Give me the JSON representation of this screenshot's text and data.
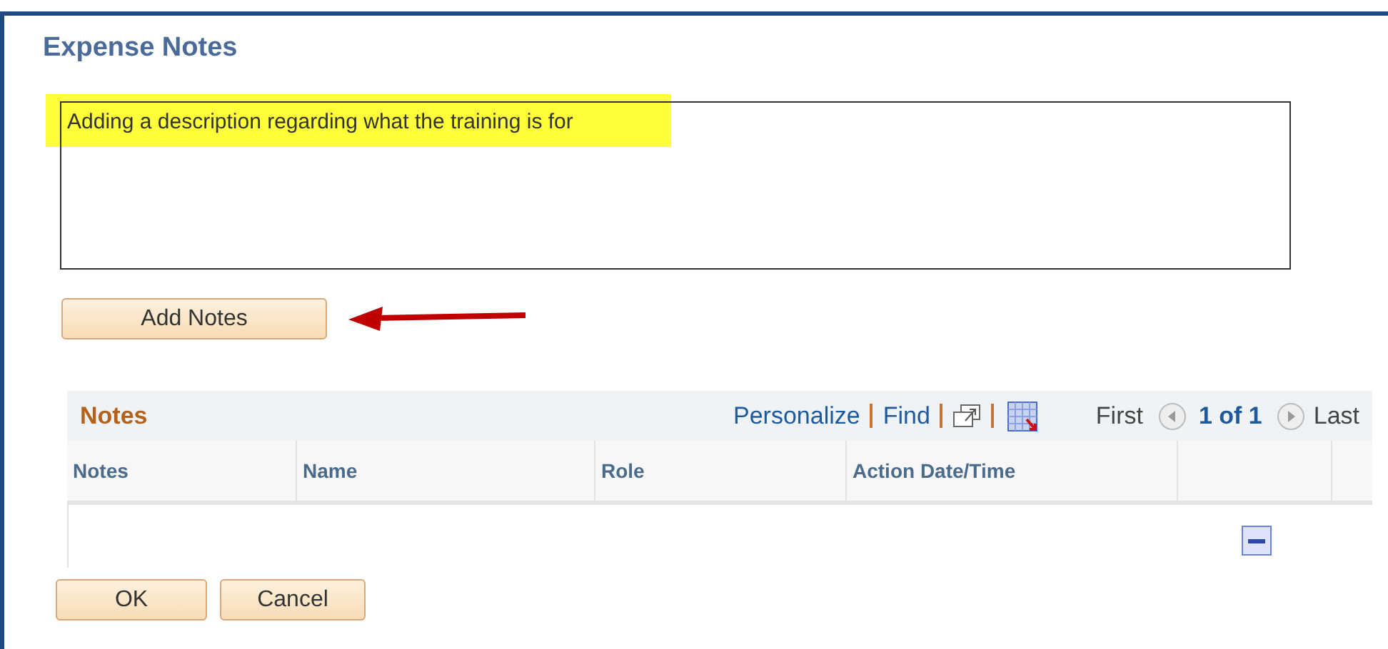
{
  "dialog": {
    "title": "Expense Notes"
  },
  "notes_field": {
    "value": "Adding a description regarding what the training is for",
    "highlighted": true
  },
  "add_button": "Add Notes",
  "grid": {
    "title": "Notes",
    "links": [
      "Personalize",
      "Find"
    ],
    "pager": {
      "first": "First",
      "position": "1 of 1",
      "last": "Last"
    },
    "columns": [
      "Notes",
      "Name",
      "Role",
      "Action Date/Time"
    ]
  },
  "buttons": [
    "OK",
    "Cancel"
  ]
}
